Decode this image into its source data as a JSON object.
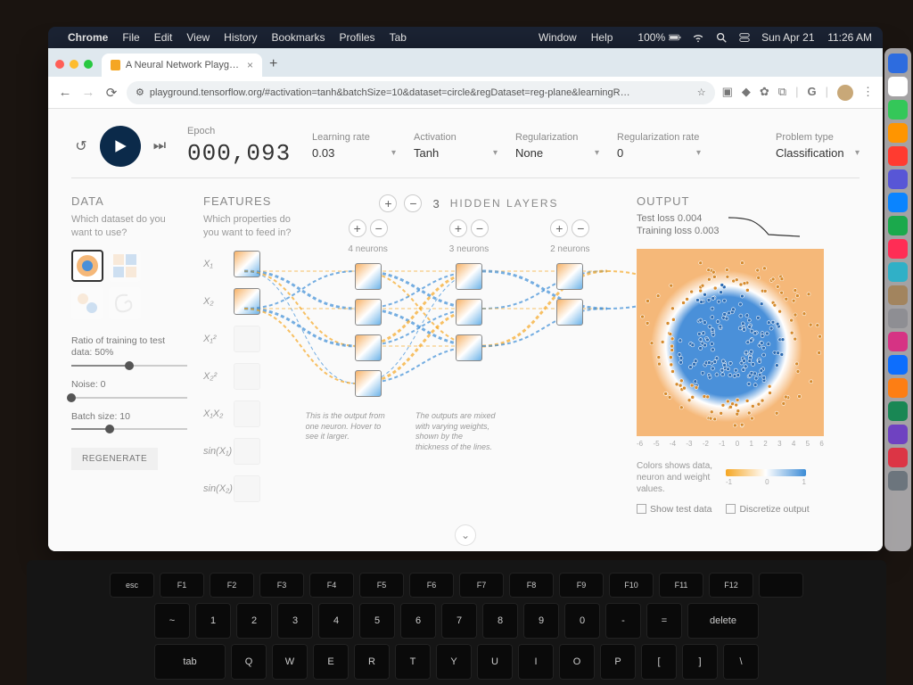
{
  "mac_menu": {
    "items": [
      "Chrome",
      "File",
      "Edit",
      "View",
      "History",
      "Bookmarks",
      "Profiles",
      "Tab"
    ],
    "right_items": [
      "Window",
      "Help"
    ],
    "battery": "100%",
    "date": "Sun Apr 21",
    "time": "11:26 AM"
  },
  "browser": {
    "tab_title": "A Neural Network Playground",
    "url": "playground.tensorflow.org/#activation=tanh&batchSize=10&dataset=circle&regDataset=reg-plane&learningR…"
  },
  "controls": {
    "epoch_label": "Epoch",
    "epoch_value": "000,093",
    "learning_rate": {
      "label": "Learning rate",
      "value": "0.03"
    },
    "activation": {
      "label": "Activation",
      "value": "Tanh"
    },
    "regularization": {
      "label": "Regularization",
      "value": "None"
    },
    "reg_rate": {
      "label": "Regularization rate",
      "value": "0"
    },
    "problem_type": {
      "label": "Problem type",
      "value": "Classification"
    }
  },
  "data": {
    "title": "DATA",
    "prompt": "Which dataset do you want to use?",
    "sliders": {
      "ratio": {
        "label": "Ratio of training to test data:  50%",
        "pct": 50
      },
      "noise": {
        "label": "Noise:  0",
        "pct": 0
      },
      "batch": {
        "label": "Batch size:  10",
        "pct": 33
      }
    },
    "regenerate": "REGENERATE"
  },
  "features": {
    "title": "FEATURES",
    "prompt": "Which properties do you want to feed in?",
    "items": [
      {
        "label": "X₁",
        "on": true
      },
      {
        "label": "X₂",
        "on": true
      },
      {
        "label": "X₁²",
        "on": false
      },
      {
        "label": "X₂²",
        "on": false
      },
      {
        "label": "X₁X₂",
        "on": false
      },
      {
        "label": "sin(X₁)",
        "on": false
      },
      {
        "label": "sin(X₂)",
        "on": false
      }
    ]
  },
  "hidden": {
    "count": "3",
    "label": "HIDDEN LAYERS",
    "layers": [
      {
        "neurons": 4,
        "label": "4 neurons"
      },
      {
        "neurons": 3,
        "label": "3 neurons"
      },
      {
        "neurons": 2,
        "label": "2 neurons"
      }
    ],
    "annotation1": "This is the output from one neuron. Hover to see it larger.",
    "annotation2": "The outputs are mixed with varying weights, shown by the thickness of the lines."
  },
  "output": {
    "title": "OUTPUT",
    "test_loss": "Test loss 0.004",
    "train_loss": "Training loss 0.003",
    "axis_ticks": [
      "-6",
      "-5",
      "-4",
      "-3",
      "-2",
      "-1",
      "0",
      "1",
      "2",
      "3",
      "4",
      "5",
      "6"
    ],
    "colormap_desc": "Colors shows data, neuron and weight values.",
    "colormap_ticks": [
      "-1",
      "0",
      "1"
    ],
    "check_test": "Show test data",
    "check_discretize": "Discretize output"
  },
  "keyboard": {
    "fn_row": [
      "esc",
      "F1",
      "F2",
      "F3",
      "F4",
      "F5",
      "F6",
      "F7",
      "F8",
      "F9",
      "F10",
      "F11",
      "F12",
      ""
    ],
    "row2": [
      "~",
      "1",
      "2",
      "3",
      "4",
      "5",
      "6",
      "7",
      "8",
      "9",
      "0",
      "-",
      "=",
      "delete"
    ],
    "row3": [
      "tab",
      "Q",
      "W",
      "E",
      "R",
      "T",
      "Y",
      "U",
      "I",
      "O",
      "P",
      "[",
      "]",
      "\\"
    ]
  },
  "dock_colors": [
    "#2d6cdf",
    "#ffffff",
    "#34c759",
    "#ff9500",
    "#ff3b30",
    "#5856d6",
    "#0a84ff",
    "#1ba94c",
    "#ff2d55",
    "#30b0c7",
    "#a2845e",
    "#8e8e93",
    "#d63384",
    "#0d6efd",
    "#fd7e14",
    "#198754",
    "#6f42c1",
    "#dc3545",
    "#6c757d"
  ]
}
